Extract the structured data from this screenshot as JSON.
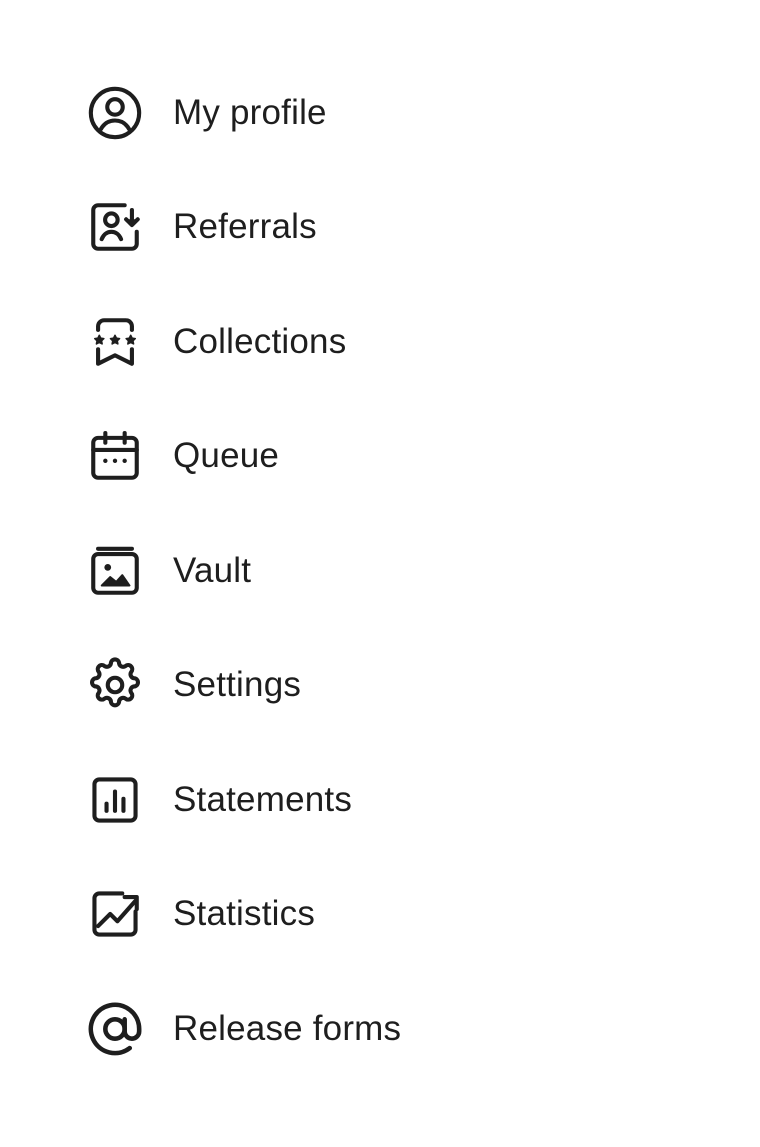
{
  "menu": {
    "items": [
      {
        "label": "My profile",
        "icon": "user-circle-icon"
      },
      {
        "label": "Referrals",
        "icon": "referral-icon"
      },
      {
        "label": "Collections",
        "icon": "collections-icon"
      },
      {
        "label": "Queue",
        "icon": "calendar-icon"
      },
      {
        "label": "Vault",
        "icon": "vault-image-icon"
      },
      {
        "label": "Settings",
        "icon": "gear-icon"
      },
      {
        "label": "Statements",
        "icon": "bar-chart-icon"
      },
      {
        "label": "Statistics",
        "icon": "trending-up-icon"
      },
      {
        "label": "Release forms",
        "icon": "at-sign-icon"
      }
    ]
  },
  "colors": {
    "background": "#ffffff",
    "text": "#1e1e1e",
    "icon": "#1e1e1e"
  }
}
